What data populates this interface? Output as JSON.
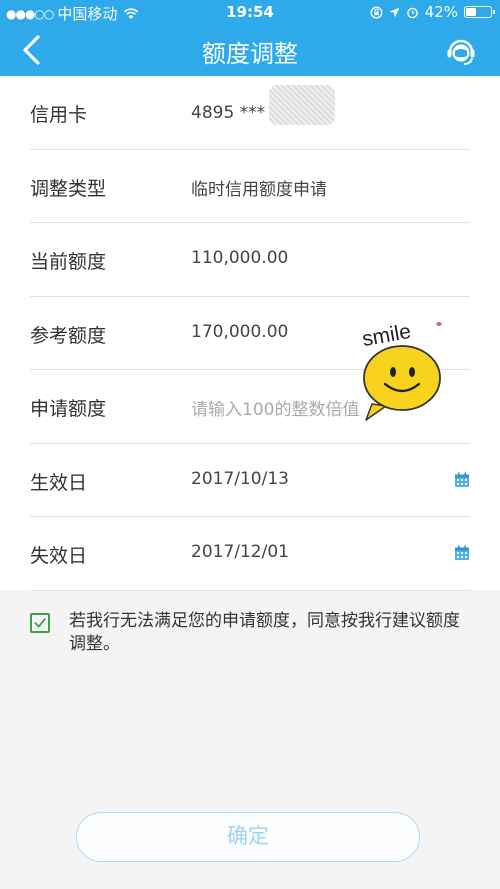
{
  "status_bar": {
    "signal_dots": "●●●○○",
    "carrier": "中国移动",
    "time": "19:54",
    "battery_percent": "42%",
    "battery_level": 0.42
  },
  "header": {
    "title": "额度调整",
    "back_icon": "chevron-left-icon",
    "service_icon": "customer-service-icon"
  },
  "form": {
    "card": {
      "label": "信用卡",
      "value": "4895 ***"
    },
    "type": {
      "label": "调整类型",
      "value": "临时信用额度申请"
    },
    "current": {
      "label": "当前额度",
      "value": "110,000.00"
    },
    "reference": {
      "label": "参考额度",
      "value": "170,000.00"
    },
    "apply": {
      "label": "申请额度",
      "placeholder": "请输入100的整数倍值"
    },
    "effective": {
      "label": "生效日",
      "value": "2017/10/13"
    },
    "expiry": {
      "label": "失效日",
      "value": "2017/12/01"
    }
  },
  "sticker": {
    "text": "smile"
  },
  "agreement": {
    "checked": true,
    "text": "若我行无法满足您的申请额度，同意按我行建议额度调整。"
  },
  "confirm_label": "确定",
  "colors": {
    "header_blue": "#2ea9ea",
    "check_green": "#3aa14c",
    "confirm_border": "#a9dcf5",
    "calendar_blue": "#4fb3ea"
  }
}
